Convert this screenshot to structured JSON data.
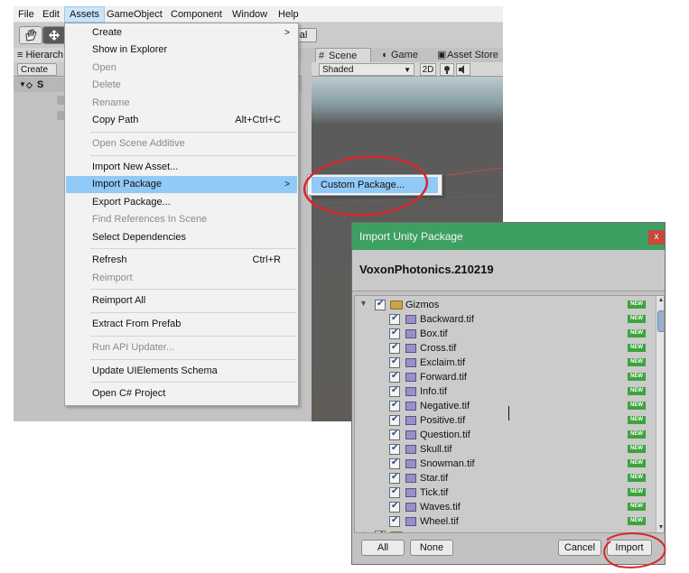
{
  "menubar": {
    "items": [
      "File",
      "Edit",
      "Assets",
      "GameObject",
      "Component",
      "Window",
      "Help"
    ]
  },
  "toolbar": {
    "global_label": "bal"
  },
  "hierarchy": {
    "tab_label": "Hierarch",
    "create_label": "Create",
    "scene_row_label": "S"
  },
  "scene_panel": {
    "tabs": [
      {
        "label": "Scene",
        "icon": "grid-icon"
      },
      {
        "label": "Game",
        "icon": "pacman-icon"
      },
      {
        "label": "Asset Store",
        "icon": "bag-icon"
      }
    ],
    "shading_mode": "Shaded",
    "mode_2d_label": "2D"
  },
  "assets_menu": {
    "items": [
      {
        "label": "Create",
        "submenu": true,
        "disabled": false
      },
      {
        "label": "Show in Explorer",
        "disabled": false
      },
      {
        "label": "Open",
        "disabled": true
      },
      {
        "label": "Delete",
        "disabled": true
      },
      {
        "label": "Rename",
        "disabled": true
      },
      {
        "label": "Copy Path",
        "shortcut": "Alt+Ctrl+C",
        "disabled": false
      },
      {
        "label": "Open Scene Additive",
        "disabled": true
      },
      {
        "label": "Import New Asset...",
        "disabled": false
      },
      {
        "label": "Import Package",
        "submenu": true,
        "highlighted": true,
        "disabled": false
      },
      {
        "label": "Export Package...",
        "disabled": false
      },
      {
        "label": "Find References In Scene",
        "disabled": true
      },
      {
        "label": "Select Dependencies",
        "disabled": false
      },
      {
        "label": "Refresh",
        "shortcut": "Ctrl+R",
        "disabled": false
      },
      {
        "label": "Reimport",
        "disabled": true
      },
      {
        "label": "Reimport All",
        "disabled": false
      },
      {
        "label": "Extract From Prefab",
        "disabled": false
      },
      {
        "label": "Run API Updater...",
        "disabled": true
      },
      {
        "label": "Update UIElements Schema",
        "disabled": false
      },
      {
        "label": "Open C# Project",
        "disabled": false
      }
    ],
    "submenu_arrow": ">"
  },
  "import_submenu": {
    "custom_package_label": "Custom Package..."
  },
  "dialog": {
    "title": "Import Unity Package",
    "close_glyph": "x",
    "package_name": "VoxonPhotonics.210219",
    "new_badge": "NEW",
    "root_folder": "Gizmos",
    "files": [
      "Backward.tif",
      "Box.tif",
      "Cross.tif",
      "Exclaim.tif",
      "Forward.tif",
      "Info.tif",
      "Negative.tif",
      "Positive.tif",
      "Question.tif",
      "Skull.tif",
      "Snowman.tif",
      "Star.tif",
      "Tick.tif",
      "Waves.tif",
      "Wheel.tif"
    ],
    "buttons": {
      "all": "All",
      "none": "None",
      "cancel": "Cancel",
      "import": "Import"
    }
  },
  "colors": {
    "dialog_titlebar": "#3e9f62",
    "menu_highlight": "#91c9f7",
    "annotation_red": "#d8262c",
    "new_badge": "#3da33d"
  }
}
